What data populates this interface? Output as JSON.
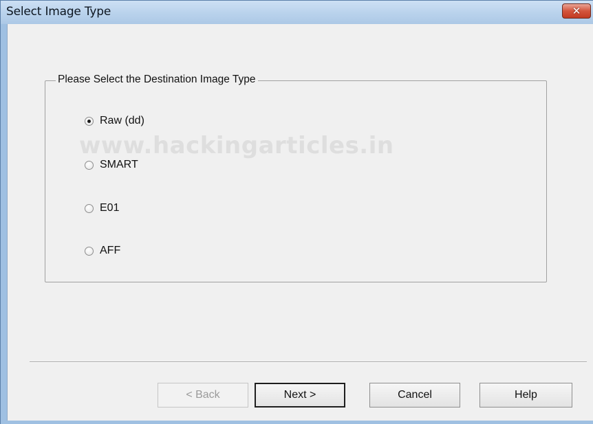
{
  "window": {
    "title": "Select Image Type",
    "close_label": "✕"
  },
  "group": {
    "legend": "Please Select the Destination Image Type"
  },
  "watermark": "www.hackingarticles.in",
  "options": [
    {
      "label": "Raw (dd)",
      "checked": true
    },
    {
      "label": "SMART",
      "checked": false
    },
    {
      "label": "E01",
      "checked": false
    },
    {
      "label": "AFF",
      "checked": false
    }
  ],
  "buttons": {
    "back": "< Back",
    "next": "Next >",
    "cancel": "Cancel",
    "help": "Help"
  }
}
